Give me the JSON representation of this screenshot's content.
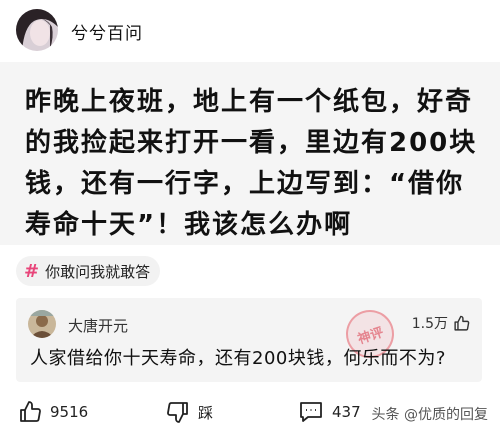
{
  "header": {
    "username": "兮兮百问"
  },
  "post": {
    "text": "昨晚上夜班，地上有一个纸包，好奇的我捡起来打开一看，里边有200块钱，还有一行字，上边写到：“借你寿命十天”！我该怎么办啊"
  },
  "topic": {
    "hash": "#",
    "label": "你敢问我就敢答"
  },
  "comment": {
    "author": "大唐开元",
    "stamp_text": "神评",
    "likes": "1.5万",
    "text": "人家借给你十天寿命，还有200块钱，何乐而不为?"
  },
  "actions": {
    "like_count": "9516",
    "dislike_label": "踩",
    "comment_count": "437"
  },
  "watermark": "头条 @优质的回复",
  "colors": {
    "topic_hash": "#e8457a",
    "post_bg": "#f5f5f5",
    "comment_bg": "#f4f4f4"
  }
}
